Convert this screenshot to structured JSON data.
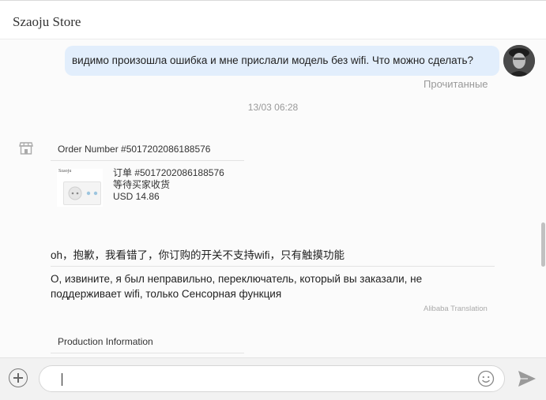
{
  "header": {
    "title": "Szaoju Store"
  },
  "messages": {
    "outgoing_text": "видимо произошла ошибка и мне прислали модель без wifi. Что можно сделать?",
    "read_status": "Прочитанные",
    "timestamp": "13/03 06:28"
  },
  "order_card": {
    "order_number": "Order Number #5017202086188576",
    "thumb_brand": "Szaoju",
    "order_line": "订单 #5017202086188576",
    "status": "等待买家收货",
    "price": "USD 14.86"
  },
  "reply": {
    "original": "oh，抱歉，我看错了，你订购的开关不支持wifi，只有触摸功能",
    "translated": "О, извините, я был неправильно, переключатель, который вы заказали, не поддерживает wifi, только Сенсорная функция",
    "translation_note": "Alibaba Translation"
  },
  "product_card": {
    "title": "Production Information"
  },
  "input": {
    "value": ""
  },
  "colors": {
    "outgoing_bubble": "#e2eefc",
    "chat_background": "#fbfbfb",
    "input_bar": "#f2f2f2"
  },
  "icons": {
    "store": "store-icon",
    "add": "plus-circle-icon",
    "emoji": "smiley-icon",
    "send": "paper-plane-icon"
  }
}
